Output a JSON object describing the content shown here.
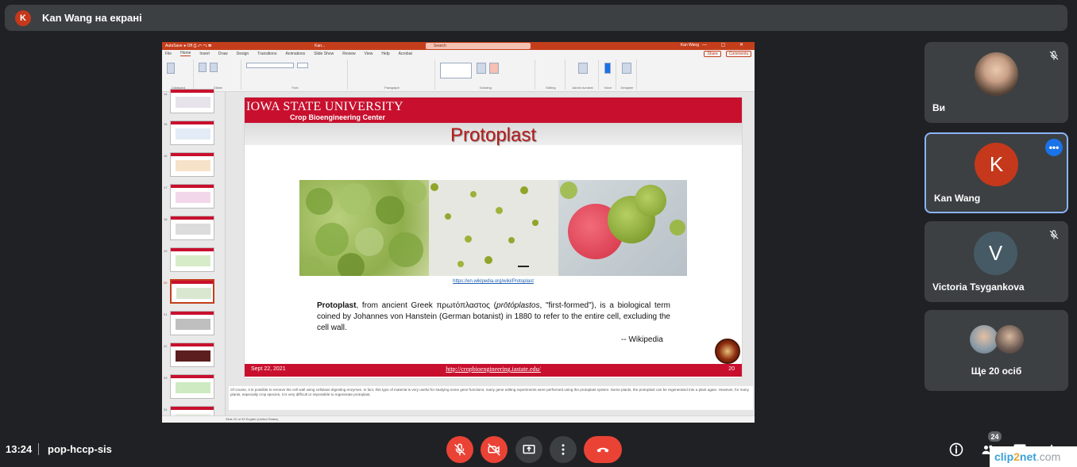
{
  "presenter_bar": {
    "avatar_letter": "K",
    "text": "Kan Wang на екрані"
  },
  "ppt": {
    "title_left": "AutoSave ● Off  ⎙ ↶ ↷  ⬒",
    "title_file": "Kan...",
    "search_placeholder": "Search",
    "user": "Kan Wang",
    "window_controls": "— ▢ ✕",
    "tabs": [
      "File",
      "Home",
      "Insert",
      "Draw",
      "Design",
      "Transitions",
      "Animations",
      "Slide Show",
      "Review",
      "View",
      "Help",
      "Acrobat"
    ],
    "share_label": "Share",
    "comments_label": "Comments",
    "ribbon_groups": [
      "Clipboard",
      "Slides",
      "Font",
      "Paragraph",
      "Drawing",
      "Editing",
      "Adobe Acrobat",
      "Voice",
      "Designer"
    ],
    "thumb_numbers": [
      "14",
      "15",
      "16",
      "17",
      "18",
      "19",
      "20",
      "21",
      "22",
      "23",
      "24"
    ],
    "notes": "Of course, it is possible to remove the cell wall using cellulase digesting enzymes. In fact, this type of material is very useful for studying some gene functions; many gene editing experiments were performed using the protoplast system. Some plants, the protoplast can be regenerated into a plant again. However, for many plants, especially crop species, it is very difficult or impossible to regenerate protoplast.",
    "status": "Slide 20 of 33   English (United States)"
  },
  "slide": {
    "university": "Iowa State University",
    "center": "Crop Bioengineering Center",
    "title": "Protoplast",
    "image_link": "https://en.wikipedia.org/wiki/Protoplast",
    "body_bold": "Protoplast",
    "body_a": ", from ancient Greek πρωτόπλαστος (",
    "body_italic": "prōtóplastos",
    "body_b": ", \"first-formed\"), is a biological term coined by Johannes von Hanstein (German botanist) in 1880 to refer to the entire cell, excluding the cell wall.",
    "attribution": "-- Wikipedia",
    "date": "Sept 22, 2021",
    "footer_url": "http://cropbioengineering.iastate.edu/",
    "slide_number": "20"
  },
  "participants": [
    {
      "name": "Ви",
      "muted": true
    },
    {
      "name": "Kan Wang",
      "letter": "K",
      "color": "#c5381b",
      "muted": false
    },
    {
      "name": "Victoria Tsygankova",
      "letter": "V",
      "color": "#455a64",
      "muted": true
    }
  ],
  "others_label": "Ще 20 осіб",
  "meeting": {
    "time": "13:24",
    "code": "pop-hccp-sis",
    "participant_count": "24"
  },
  "watermark": {
    "a": "clip",
    "b": "2",
    "c": "net",
    "d": ".com"
  }
}
